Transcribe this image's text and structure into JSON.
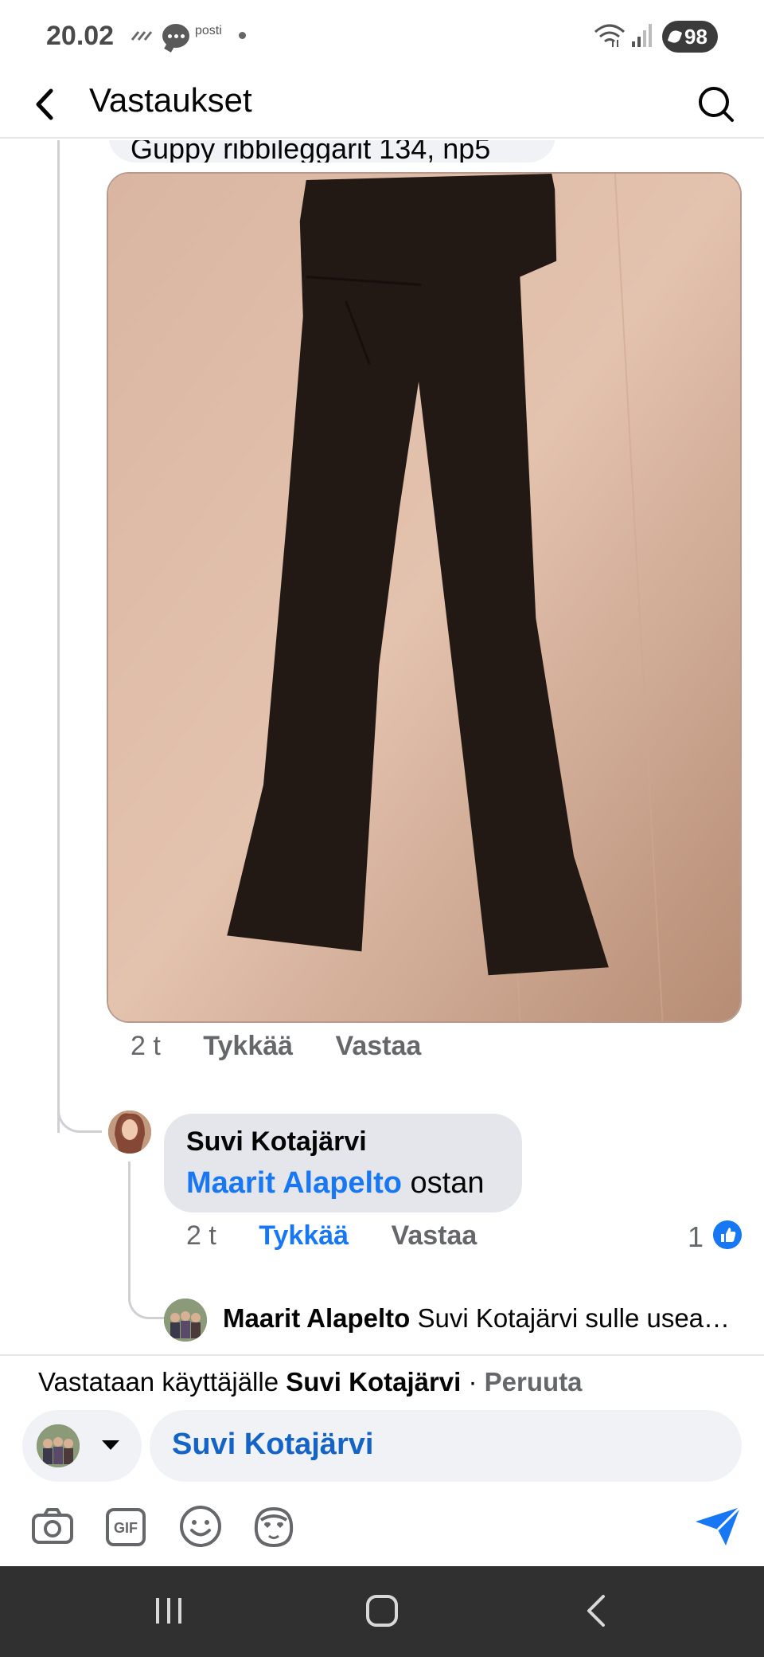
{
  "status_bar": {
    "time": "20.02",
    "notification_label": "posti",
    "battery": "98"
  },
  "header": {
    "title": "Vastaukset",
    "back_icon": "arrow-left-icon",
    "search_icon": "search-icon"
  },
  "thread": {
    "previous_comment_text": "Guppy ribbileggarit 134, np5",
    "photo_alt": "black flared pants",
    "comment_meta": {
      "time": "2 t",
      "like_label": "Tykkää",
      "reply_label": "Vastaa"
    },
    "reply": {
      "author": "Suvi Kotajärvi",
      "mention": "Maarit Alapelto",
      "text": "ostan",
      "meta": {
        "time": "2 t",
        "like_label": "Tykkää",
        "reply_label": "Vastaa"
      },
      "like_count": "1"
    },
    "nested_reply": {
      "author": "Maarit Alapelto",
      "text": "Suvi Kotajärvi sulle usea…"
    }
  },
  "composer": {
    "replying_prefix": "Vastataan käyttäjälle",
    "replying_name": "Suvi Kotajärvi",
    "separator": "·",
    "cancel_label": "Peruuta",
    "input_value": "Suvi Kotajärvi",
    "tools": [
      "camera-icon",
      "gif-icon",
      "emoji-icon",
      "avatar-sticker-icon"
    ],
    "gif_label": "GIF"
  },
  "colors": {
    "accent": "#1877f2",
    "mention_blue": "#1464c8",
    "meta_gray": "#65676b",
    "bubble_gray": "#e4e6eb",
    "nav_bar": "#303030"
  }
}
